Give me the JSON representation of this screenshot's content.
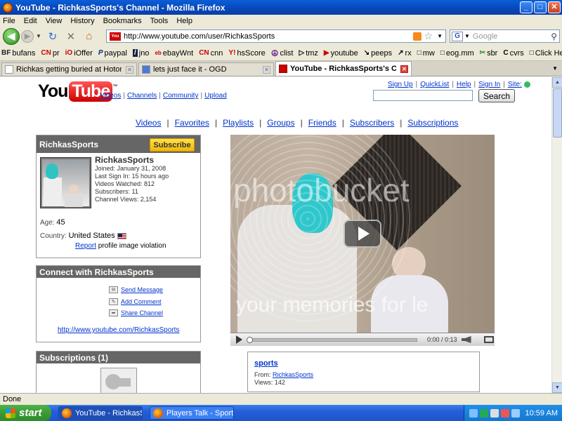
{
  "window": {
    "title": "YouTube - RichkasSports's Channel - Mozilla Firefox",
    "minimize": "_",
    "maximize": "□",
    "close": "✕"
  },
  "menu": [
    "File",
    "Edit",
    "View",
    "History",
    "Bookmarks",
    "Tools",
    "Help"
  ],
  "navbar": {
    "url": "http://www.youtube.com/user/RichkasSports",
    "search_placeholder": "Google",
    "search_engine_letter": "G"
  },
  "bookmarks": [
    {
      "icon": "BF",
      "label": "bufans"
    },
    {
      "icon": "CN",
      "label": "pr"
    },
    {
      "icon": "iO",
      "label": "iOffer"
    },
    {
      "icon": "P",
      "label": "paypal"
    },
    {
      "icon": "/",
      "label": "jno"
    },
    {
      "icon": "eb",
      "label": "ebayWnt"
    },
    {
      "icon": "CN",
      "label": "cnn"
    },
    {
      "icon": "Y!",
      "label": "hsScore"
    },
    {
      "icon": "☮",
      "label": "clist"
    },
    {
      "icon": "▷",
      "label": "tmz"
    },
    {
      "icon": "▶",
      "label": "youtube"
    },
    {
      "icon": "↘",
      "label": "peeps"
    },
    {
      "icon": "↗",
      "label": "rx"
    },
    {
      "icon": "□",
      "label": "mw"
    },
    {
      "icon": "□",
      "label": "eog.mm"
    },
    {
      "icon": "✂",
      "label": "sbr"
    },
    {
      "icon": "C",
      "label": "cvrs"
    },
    {
      "icon": "□",
      "label": "Click Here"
    }
  ],
  "tabs": [
    {
      "label": "Richkas getting buried at HotorNot.com...",
      "active": false
    },
    {
      "label": "lets just face it - OGD",
      "active": false
    },
    {
      "label": "YouTube - RichkasSports's Channel",
      "active": true
    }
  ],
  "yt_header": {
    "logo_you": "You",
    "logo_tube": "Tube",
    "logo_tm": "™",
    "links": [
      "Videos",
      "Channels",
      "Community",
      "Upload"
    ],
    "user_links": [
      "Sign Up",
      "QuickList",
      "Help",
      "Sign In",
      "Site:"
    ],
    "search_button": "Search"
  },
  "channel_nav": [
    "Videos",
    "Favorites",
    "Playlists",
    "Groups",
    "Friends",
    "Subscribers",
    "Subscriptions"
  ],
  "profile": {
    "header_name": "RichkasSports",
    "subscribe_label": "Subscribe",
    "username": "RichkasSports",
    "joined": "Joined: January 31, 2008",
    "last_sign_in": "Last Sign In: 15 hours ago",
    "videos_watched": "Videos Watched: 812",
    "subscribers": "Subscribers: 11",
    "channel_views": "Channel Views: 2,154",
    "age_label": "Age:",
    "age_value": "45",
    "country_label": "Country:",
    "country_value": "United States",
    "report_link": "Report",
    "report_text": " profile image violation"
  },
  "connect": {
    "header": "Connect with RichkasSports",
    "send_message": "Send Message",
    "add_comment": "Add Comment",
    "share_channel": "Share Channel",
    "channel_url": "http://www.youtube.com/RichkasSports"
  },
  "subscriptions": {
    "header": "Subscriptions (1)"
  },
  "player": {
    "watermark_top": "photobucket",
    "watermark_bottom": "your memories for le",
    "time": "0:00 / 0:13"
  },
  "video_info": {
    "title": "sports",
    "from_label": "From: ",
    "from_user": "RichkasSports",
    "views": "Views: 142"
  },
  "status": "Done",
  "taskbar": {
    "start": "start",
    "tasks": [
      {
        "label": "YouTube - RichkasSp...",
        "active": true
      },
      {
        "label": "Players Talk - Sports ...",
        "active": false
      }
    ],
    "clock": "10:59 AM"
  }
}
